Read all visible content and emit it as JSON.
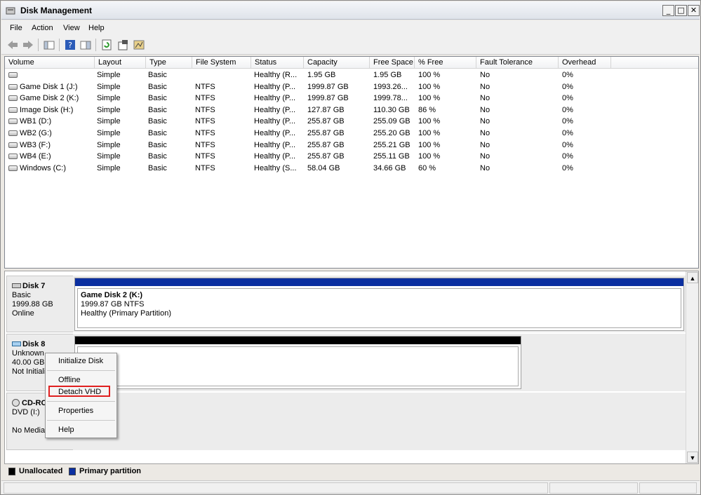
{
  "window": {
    "title": "Disk Management",
    "icon": "disk-management-icon"
  },
  "menu": [
    "File",
    "Action",
    "View",
    "Help"
  ],
  "toolbar": [
    "back-arrow-icon",
    "forward-arrow-icon",
    "console-tree-icon",
    "help-icon",
    "action-pane-icon",
    "refresh-icon",
    "properties-icon",
    "rescan-icon"
  ],
  "columns": [
    "Volume",
    "Layout",
    "Type",
    "File System",
    "Status",
    "Capacity",
    "Free Space",
    "% Free",
    "Fault Tolerance",
    "Overhead"
  ],
  "volumes": [
    [
      "",
      "Simple",
      "Basic",
      "",
      "Healthy (R...",
      "1.95 GB",
      "1.95 GB",
      "100 %",
      "No",
      "0%"
    ],
    [
      "Game Disk 1 (J:)",
      "Simple",
      "Basic",
      "NTFS",
      "Healthy (P...",
      "1999.87 GB",
      "1993.26...",
      "100 %",
      "No",
      "0%"
    ],
    [
      "Game Disk 2 (K:)",
      "Simple",
      "Basic",
      "NTFS",
      "Healthy (P...",
      "1999.87 GB",
      "1999.78...",
      "100 %",
      "No",
      "0%"
    ],
    [
      "Image Disk (H:)",
      "Simple",
      "Basic",
      "NTFS",
      "Healthy (P...",
      "127.87 GB",
      "110.30 GB",
      "86 %",
      "No",
      "0%"
    ],
    [
      "WB1 (D:)",
      "Simple",
      "Basic",
      "NTFS",
      "Healthy (P...",
      "255.87 GB",
      "255.09 GB",
      "100 %",
      "No",
      "0%"
    ],
    [
      "WB2 (G:)",
      "Simple",
      "Basic",
      "NTFS",
      "Healthy (P...",
      "255.87 GB",
      "255.20 GB",
      "100 %",
      "No",
      "0%"
    ],
    [
      "WB3 (F:)",
      "Simple",
      "Basic",
      "NTFS",
      "Healthy (P...",
      "255.87 GB",
      "255.21 GB",
      "100 %",
      "No",
      "0%"
    ],
    [
      "WB4 (E:)",
      "Simple",
      "Basic",
      "NTFS",
      "Healthy (P...",
      "255.87 GB",
      "255.11 GB",
      "100 %",
      "No",
      "0%"
    ],
    [
      "Windows (C:)",
      "Simple",
      "Basic",
      "NTFS",
      "Healthy (S...",
      "58.04 GB",
      "34.66 GB",
      "60 %",
      "No",
      "0%"
    ]
  ],
  "disks": {
    "disk7": {
      "name": "Disk 7",
      "type": "Basic",
      "size": "1999.88 GB",
      "status": "Online",
      "partition": {
        "name": "Game Disk 2  (K:)",
        "size": "1999.87 GB NTFS",
        "status": "Healthy (Primary Partition)"
      }
    },
    "disk8": {
      "name": "Disk 8",
      "type": "Unknown",
      "size": "40.00 GB",
      "status": "Not Initiali"
    },
    "cdrom": {
      "name": "CD-RO",
      "type": "DVD (I:)",
      "status": "No Media"
    }
  },
  "context_menu": [
    "Initialize Disk",
    "Offline",
    "Detach VHD",
    "Properties",
    "Help"
  ],
  "legend": {
    "unallocated": "Unallocated",
    "primary": "Primary partition"
  },
  "colors": {
    "primary": "#0b2fa0",
    "unallocated": "#000000",
    "highlight": "#e02020"
  }
}
